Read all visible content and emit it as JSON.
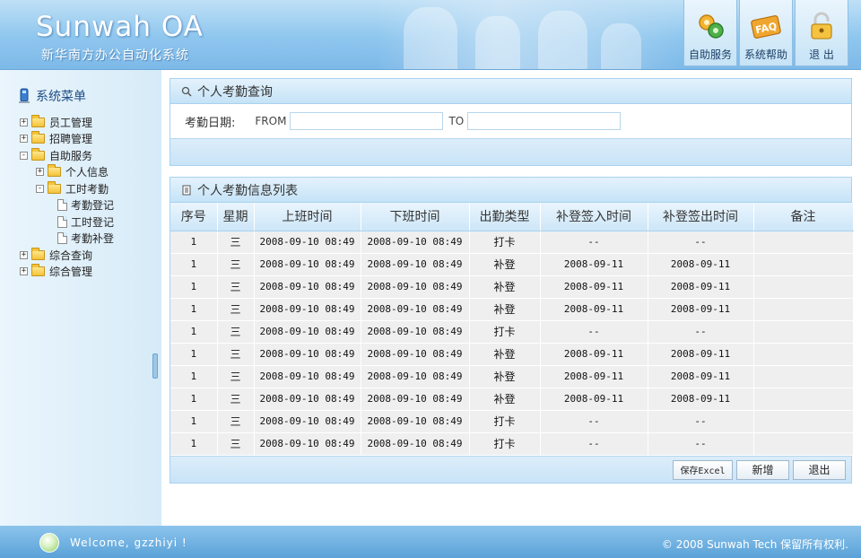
{
  "header": {
    "logo": "Sunwah OA",
    "subtitle": "新华南方办公自动化系统",
    "buttons": [
      {
        "label": "自助服务",
        "icon": "gears-icon"
      },
      {
        "label": "系统帮助",
        "icon": "faq-icon"
      },
      {
        "label": "退 出",
        "icon": "lock-icon"
      }
    ]
  },
  "sidebar": {
    "title": "系统菜单",
    "tree": [
      {
        "label": "员工管理",
        "toggle": "+",
        "level": 0,
        "kind": "folder"
      },
      {
        "label": "招聘管理",
        "toggle": "+",
        "level": 0,
        "kind": "folder"
      },
      {
        "label": "自助服务",
        "toggle": "-",
        "level": 0,
        "kind": "folder"
      },
      {
        "label": "个人信息",
        "toggle": "+",
        "level": 1,
        "kind": "folder"
      },
      {
        "label": "工时考勤",
        "toggle": "-",
        "level": 1,
        "kind": "folder"
      },
      {
        "label": "考勤登记",
        "level": 2,
        "kind": "doc"
      },
      {
        "label": "工时登记",
        "level": 2,
        "kind": "doc"
      },
      {
        "label": "考勤补登",
        "level": 2,
        "kind": "doc"
      },
      {
        "label": "综合查询",
        "toggle": "+",
        "level": 0,
        "kind": "folder"
      },
      {
        "label": "综合管理",
        "toggle": "+",
        "level": 0,
        "kind": "folder"
      }
    ]
  },
  "query": {
    "title": "个人考勤查询",
    "date_label": "考勤日期:",
    "from_label": "FROM",
    "to_label": "TO",
    "from_value": "",
    "to_value": ""
  },
  "list": {
    "title": "个人考勤信息列表",
    "columns": [
      "序号",
      "星期",
      "上班时间",
      "下班时间",
      "出勤类型",
      "补登签入时间",
      "补登签出时间",
      "备注"
    ],
    "rows": [
      [
        "1",
        "三",
        "2008-09-10 08:49",
        "2008-09-10 08:49",
        "打卡",
        "--",
        "--",
        ""
      ],
      [
        "1",
        "三",
        "2008-09-10 08:49",
        "2008-09-10 08:49",
        "补登",
        "2008-09-11",
        "2008-09-11",
        ""
      ],
      [
        "1",
        "三",
        "2008-09-10 08:49",
        "2008-09-10 08:49",
        "补登",
        "2008-09-11",
        "2008-09-11",
        ""
      ],
      [
        "1",
        "三",
        "2008-09-10 08:49",
        "2008-09-10 08:49",
        "补登",
        "2008-09-11",
        "2008-09-11",
        ""
      ],
      [
        "1",
        "三",
        "2008-09-10 08:49",
        "2008-09-10 08:49",
        "打卡",
        "--",
        "--",
        ""
      ],
      [
        "1",
        "三",
        "2008-09-10 08:49",
        "2008-09-10 08:49",
        "补登",
        "2008-09-11",
        "2008-09-11",
        ""
      ],
      [
        "1",
        "三",
        "2008-09-10 08:49",
        "2008-09-10 08:49",
        "补登",
        "2008-09-11",
        "2008-09-11",
        ""
      ],
      [
        "1",
        "三",
        "2008-09-10 08:49",
        "2008-09-10 08:49",
        "补登",
        "2008-09-11",
        "2008-09-11",
        ""
      ],
      [
        "1",
        "三",
        "2008-09-10 08:49",
        "2008-09-10 08:49",
        "打卡",
        "--",
        "--",
        ""
      ],
      [
        "1",
        "三",
        "2008-09-10 08:49",
        "2008-09-10 08:49",
        "打卡",
        "--",
        "--",
        ""
      ]
    ],
    "buttons": {
      "export": "保存Excel",
      "add": "新增",
      "back": "退出"
    }
  },
  "footer": {
    "welcome": "Welcome, gzzhiyi !",
    "copyright": "© 2008 Sunwah Tech  保留所有权利."
  },
  "colors": {
    "accent": "#7db9e8",
    "panel_border": "#a9d2ef",
    "row_bg": "#efefef"
  }
}
